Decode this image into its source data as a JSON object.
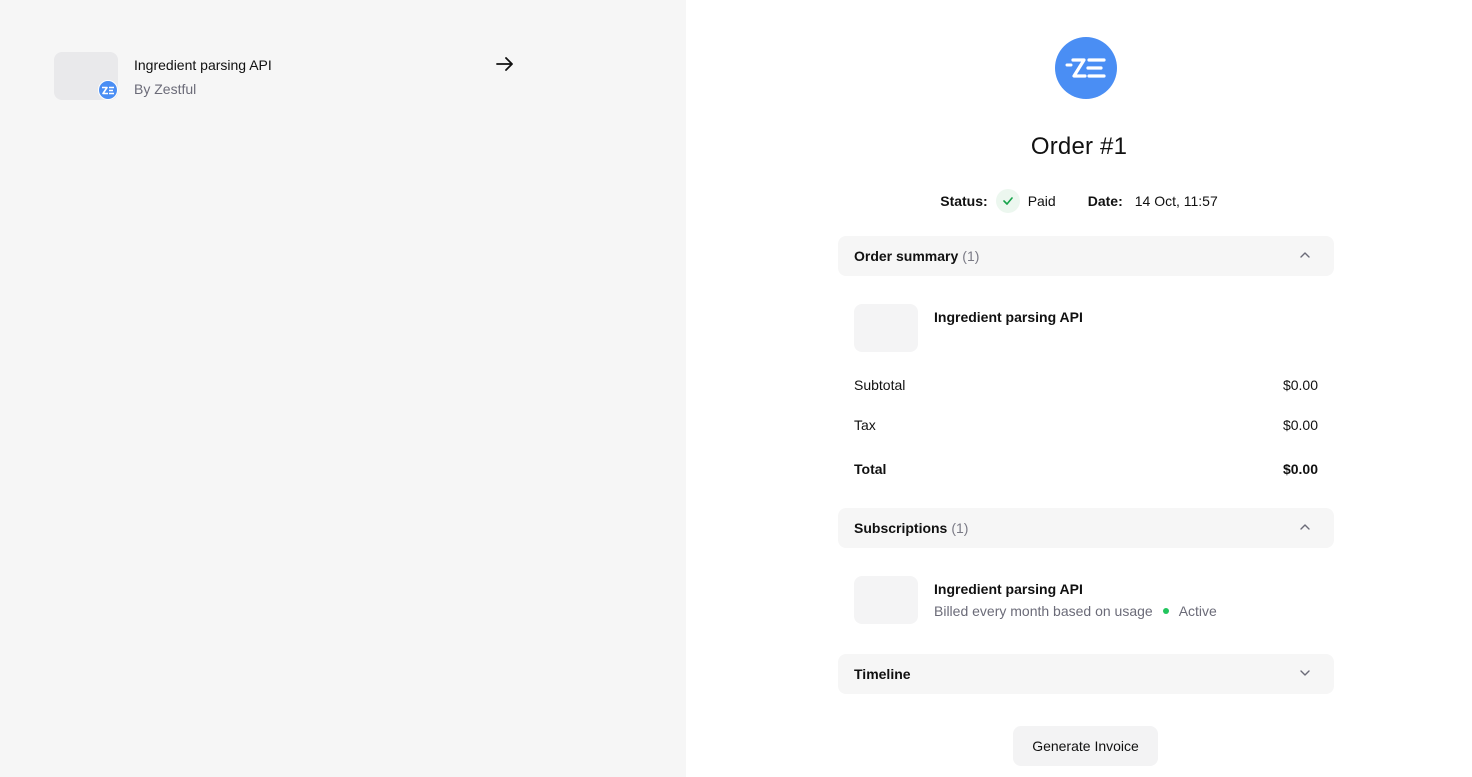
{
  "product_card": {
    "name": "Ingredient parsing API",
    "vendor": "By Zestful"
  },
  "order": {
    "title": "Order #1",
    "status_label": "Status:",
    "status_value": "Paid",
    "date_label": "Date:",
    "date_value": "14 Oct, 11:57"
  },
  "order_summary": {
    "label": "Order summary",
    "count": "(1)",
    "item_name": "Ingredient parsing API",
    "subtotal_label": "Subtotal",
    "subtotal_value": "$0.00",
    "tax_label": "Tax",
    "tax_value": "$0.00",
    "total_label": "Total",
    "total_value": "$0.00"
  },
  "subscriptions": {
    "label": "Subscriptions",
    "count": "(1)",
    "item_name": "Ingredient parsing API",
    "billing": "Billed every month based on usage",
    "status": "Active"
  },
  "timeline": {
    "label": "Timeline"
  },
  "actions": {
    "generate_invoice": "Generate Invoice"
  },
  "colors": {
    "brand": "#4a8ef4",
    "active": "#22c55e",
    "paid_check": "#16a34a"
  },
  "icons": [
    "arrow-right-icon",
    "zestful-logo",
    "check-icon",
    "chevron-up-icon",
    "chevron-down-icon"
  ]
}
